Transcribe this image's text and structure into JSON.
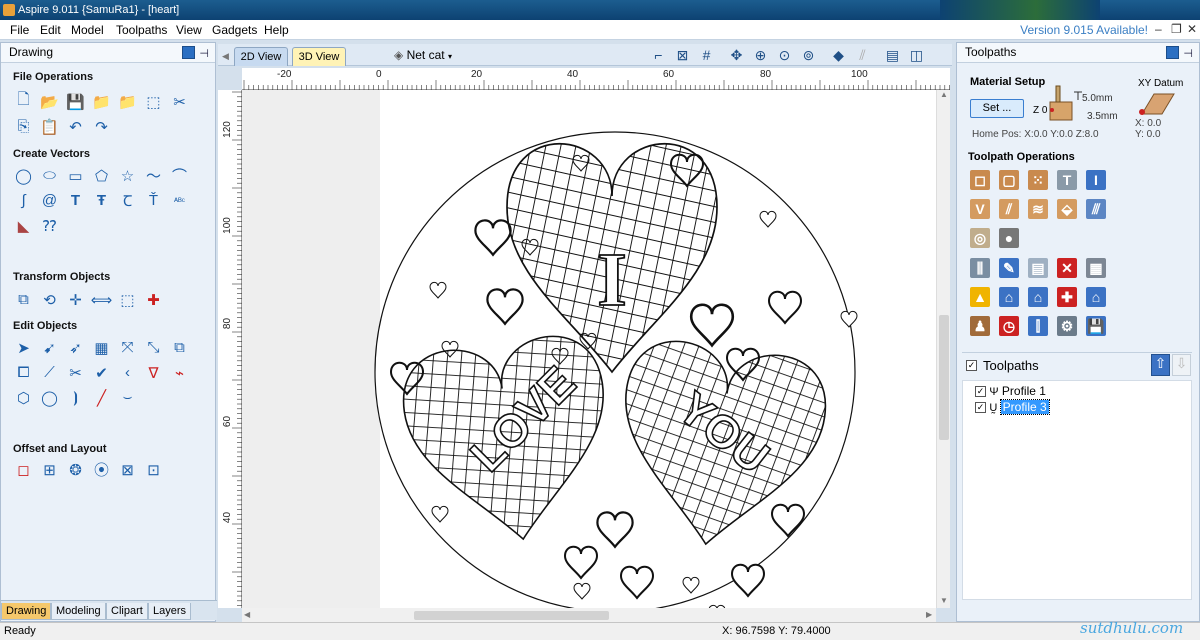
{
  "window": {
    "title": "Aspire 9.011 {SamuRa1} - [heart]"
  },
  "menu": {
    "items": [
      "File",
      "Edit",
      "Model",
      "Toolpaths",
      "View",
      "Gadgets",
      "Help"
    ],
    "version_notice": "Version 9.015 Available!"
  },
  "left_panel": {
    "title": "Drawing",
    "sections": {
      "file_ops": "File Operations",
      "create_vectors": "Create Vectors",
      "transform": "Transform Objects",
      "edit_objects": "Edit Objects",
      "offset_layout": "Offset and Layout"
    },
    "bottom_tabs": [
      "Drawing",
      "Modeling",
      "Clipart",
      "Layers"
    ]
  },
  "view": {
    "tab_2d": "2D View",
    "tab_3d": "3D View",
    "layer_select": "Net cat",
    "ruler_h": [
      "-20",
      "0",
      "20",
      "40",
      "60",
      "80",
      "100"
    ],
    "ruler_v": [
      "120",
      "100",
      "80",
      "60",
      "40"
    ],
    "art_text": [
      "I",
      "LOVE",
      "YOU"
    ]
  },
  "right_panel": {
    "title": "Toolpaths",
    "material_setup": "Material Setup",
    "set_button": "Set ...",
    "z0": "Z 0",
    "thickness": "5.0mm",
    "offset": "3.5mm",
    "home_pos": "Home Pos:  X:0.0 Y:0.0 Z:8.0",
    "xy_datum": "XY Datum",
    "datum_x": "X: 0.0",
    "datum_y": "Y: 0.0",
    "toolpath_ops": "Toolpath Operations",
    "toolpaths_header": "Toolpaths",
    "toolpaths": [
      {
        "name": "Profile 1",
        "checked": true,
        "selected": false
      },
      {
        "name": "Profile 3",
        "checked": true,
        "selected": true
      }
    ]
  },
  "status": {
    "left": "Ready",
    "coords": "X: 96.7598 Y: 79.4000"
  },
  "watermark": "sutdhulu.com"
}
